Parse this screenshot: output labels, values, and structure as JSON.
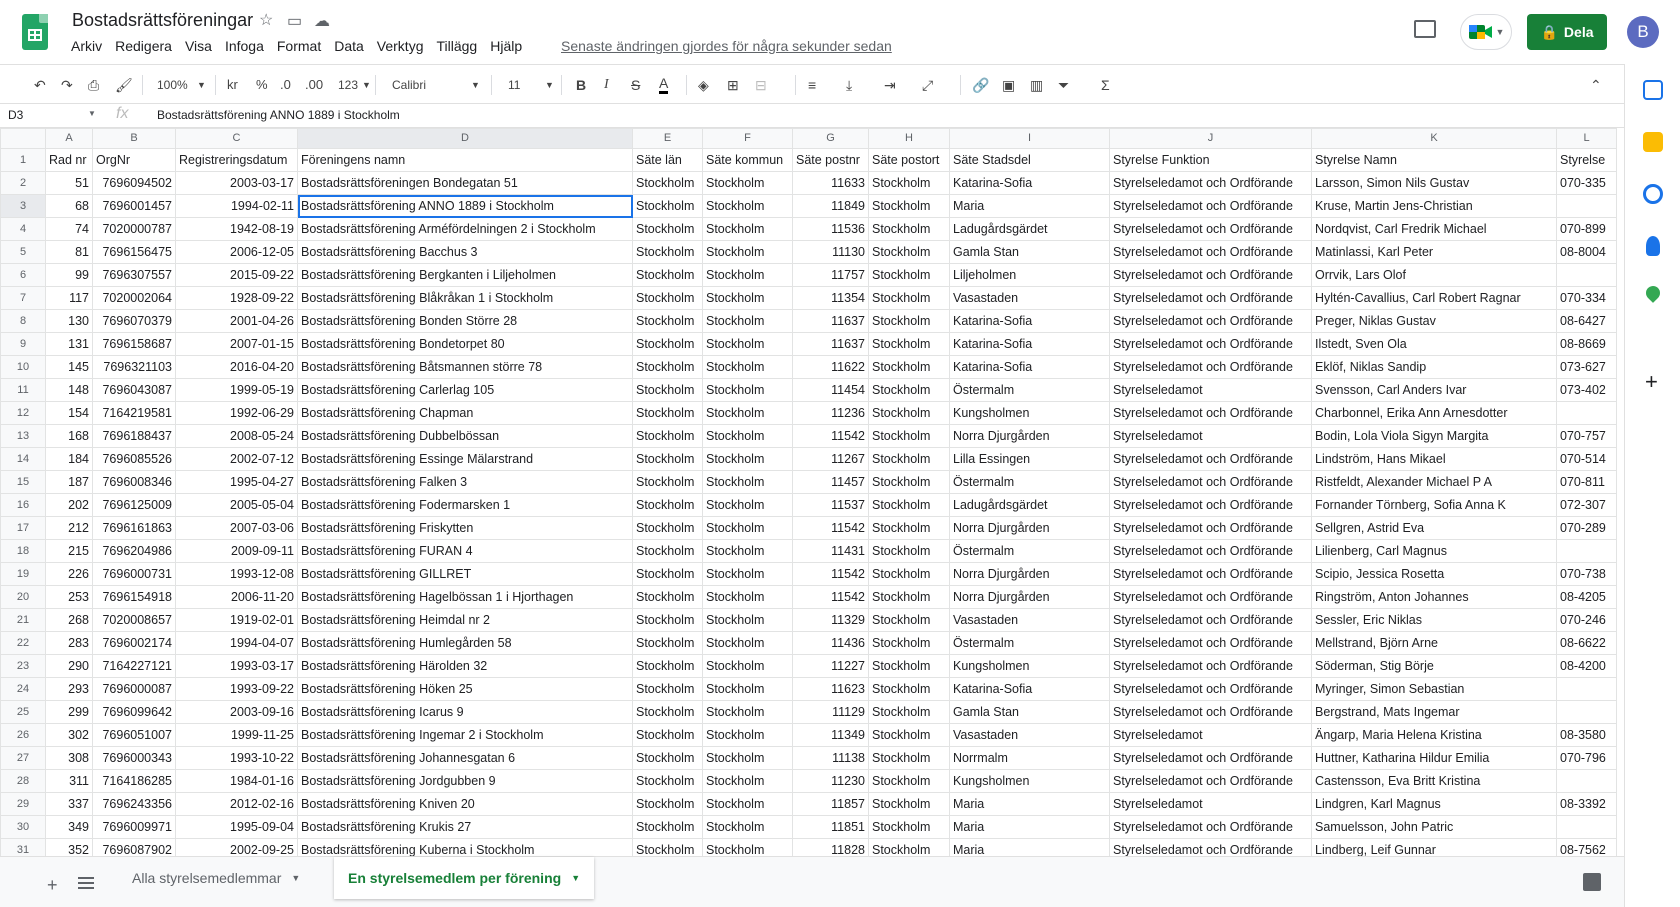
{
  "header": {
    "doc_title": "Bostadsrättsföreningar",
    "menu": [
      "Arkiv",
      "Redigera",
      "Visa",
      "Infoga",
      "Format",
      "Data",
      "Verktyg",
      "Tillägg",
      "Hjälp"
    ],
    "last_edit": "Senaste ändringen gjordes för några sekunder sedan",
    "share_label": "Dela",
    "avatar_initial": "B"
  },
  "toolbar": {
    "zoom": "100%",
    "currency": "kr",
    "percent": "%",
    "decrease_decimals": ".0",
    "increase_decimals": ".00",
    "more_formats": "123",
    "font": "Calibri",
    "font_size": "11",
    "bold": "B",
    "italic": "I",
    "strike": "S",
    "text_color": "A"
  },
  "formula_bar": {
    "cell_ref": "D3",
    "fx": "fx",
    "content": "Bostadsrättsförening ANNO 1889 i Stockholm"
  },
  "columns": [
    "A",
    "B",
    "C",
    "D",
    "E",
    "F",
    "G",
    "H",
    "I",
    "J",
    "K",
    "L"
  ],
  "rows": [
    [
      "Rad nr",
      "OrgNr",
      "Registreringsdatum",
      "Föreningens namn",
      "Säte län",
      "Säte kommun",
      "Säte postnr",
      "Säte postort",
      "Säte Stadsdel",
      "Styrelse Funktion",
      "Styrelse Namn",
      "Styrelse"
    ],
    [
      "51",
      "7696094502",
      "2003-03-17",
      "Bostadsrättsföreningen Bondegatan 51",
      "Stockholm",
      "Stockholm",
      "11633",
      "Stockholm",
      "Katarina-Sofia",
      "Styrelseledamot och Ordförande",
      "Larsson, Simon Nils Gustav",
      "070-335"
    ],
    [
      "68",
      "7696001457",
      "1994-02-11",
      "Bostadsrättsförening ANNO 1889 i Stockholm",
      "Stockholm",
      "Stockholm",
      "11849",
      "Stockholm",
      "Maria",
      "Styrelseledamot och Ordförande",
      "Kruse, Martin Jens-Christian",
      ""
    ],
    [
      "74",
      "7020000787",
      "1942-08-19",
      "Bostadsrättsförening Arméfördelningen 2 i Stockholm",
      "Stockholm",
      "Stockholm",
      "11536",
      "Stockholm",
      "Ladugårdsgärdet",
      "Styrelseledamot och Ordförande",
      "Nordqvist, Carl Fredrik Michael",
      "070-899"
    ],
    [
      "81",
      "7696156475",
      "2006-12-05",
      "Bostadsrättsförening Bacchus 3",
      "Stockholm",
      "Stockholm",
      "11130",
      "Stockholm",
      "Gamla Stan",
      "Styrelseledamot och Ordförande",
      "Matinlassi, Karl Peter",
      "08-8004"
    ],
    [
      "99",
      "7696307557",
      "2015-09-22",
      "Bostadsrättsförening Bergkanten i Liljeholmen",
      "Stockholm",
      "Stockholm",
      "11757",
      "Stockholm",
      "Liljeholmen",
      "Styrelseledamot och Ordförande",
      "Orrvik, Lars Olof",
      ""
    ],
    [
      "117",
      "7020002064",
      "1928-09-22",
      "Bostadsrättsförening Blåkråkan 1 i Stockholm",
      "Stockholm",
      "Stockholm",
      "11354",
      "Stockholm",
      "Vasastaden",
      "Styrelseledamot och Ordförande",
      "Hyltén-Cavallius, Carl Robert Ragnar",
      "070-334"
    ],
    [
      "130",
      "7696070379",
      "2001-04-26",
      "Bostadsrättsförening Bonden Större 28",
      "Stockholm",
      "Stockholm",
      "11637",
      "Stockholm",
      "Katarina-Sofia",
      "Styrelseledamot och Ordförande",
      "Preger, Niklas Gustav",
      "08-6427"
    ],
    [
      "131",
      "7696158687",
      "2007-01-15",
      "Bostadsrättsförening Bondetorpet 80",
      "Stockholm",
      "Stockholm",
      "11637",
      "Stockholm",
      "Katarina-Sofia",
      "Styrelseledamot och Ordförande",
      "Ilstedt, Sven Ola",
      "08-8669"
    ],
    [
      "145",
      "7696321103",
      "2016-04-20",
      "Bostadsrättsförening Båtsmannen större 78",
      "Stockholm",
      "Stockholm",
      "11622",
      "Stockholm",
      "Katarina-Sofia",
      "Styrelseledamot och Ordförande",
      "Eklöf, Niklas Sandip",
      "073-627"
    ],
    [
      "148",
      "7696043087",
      "1999-05-19",
      "Bostadsrättsförening Carlerlag 105",
      "Stockholm",
      "Stockholm",
      "11454",
      "Stockholm",
      "Östermalm",
      "Styrelseledamot",
      "Svensson, Carl Anders Ivar",
      "073-402"
    ],
    [
      "154",
      "7164219581",
      "1992-06-29",
      "Bostadsrättsförening Chapman",
      "Stockholm",
      "Stockholm",
      "11236",
      "Stockholm",
      "Kungsholmen",
      "Styrelseledamot och Ordförande",
      "Charbonnel, Erika Ann Arnesdotter",
      ""
    ],
    [
      "168",
      "7696188437",
      "2008-05-24",
      "Bostadsrättsförening Dubbelbössan",
      "Stockholm",
      "Stockholm",
      "11542",
      "Stockholm",
      "Norra Djurgården",
      "Styrelseledamot",
      "Bodin, Lola Viola Sigyn Margita",
      "070-757"
    ],
    [
      "184",
      "7696085526",
      "2002-07-12",
      "Bostadsrättsförening Essinge Mälarstrand",
      "Stockholm",
      "Stockholm",
      "11267",
      "Stockholm",
      "Lilla Essingen",
      "Styrelseledamot och Ordförande",
      "Lindström, Hans Mikael",
      "070-514"
    ],
    [
      "187",
      "7696008346",
      "1995-04-27",
      "Bostadsrättsförening Falken 3",
      "Stockholm",
      "Stockholm",
      "11457",
      "Stockholm",
      "Östermalm",
      "Styrelseledamot och Ordförande",
      "Ristfeldt, Alexander Michael P A",
      "070-811"
    ],
    [
      "202",
      "7696125009",
      "2005-05-04",
      "Bostadsrättsförening Fodermarsken 1",
      "Stockholm",
      "Stockholm",
      "11537",
      "Stockholm",
      "Ladugårdsgärdet",
      "Styrelseledamot och Ordförande",
      "Fornander Törnberg, Sofia Anna K",
      "072-307"
    ],
    [
      "212",
      "7696161863",
      "2007-03-06",
      "Bostadsrättsförening Friskytten",
      "Stockholm",
      "Stockholm",
      "11542",
      "Stockholm",
      "Norra Djurgården",
      "Styrelseledamot och Ordförande",
      "Sellgren, Astrid Eva",
      "070-289"
    ],
    [
      "215",
      "7696204986",
      "2009-09-11",
      "Bostadsrättsförening FURAN 4",
      "Stockholm",
      "Stockholm",
      "11431",
      "Stockholm",
      "Östermalm",
      "Styrelseledamot och Ordförande",
      "Lilienberg, Carl Magnus",
      ""
    ],
    [
      "226",
      "7696000731",
      "1993-12-08",
      "Bostadsrättsförening GILLRET",
      "Stockholm",
      "Stockholm",
      "11542",
      "Stockholm",
      "Norra Djurgården",
      "Styrelseledamot och Ordförande",
      "Scipio, Jessica Rosetta",
      "070-738"
    ],
    [
      "253",
      "7696154918",
      "2006-11-20",
      "Bostadsrättsförening Hagelbössan 1 i Hjorthagen",
      "Stockholm",
      "Stockholm",
      "11542",
      "Stockholm",
      "Norra Djurgården",
      "Styrelseledamot och Ordförande",
      "Ringström, Anton Johannes",
      "08-4205"
    ],
    [
      "268",
      "7020008657",
      "1919-02-01",
      "Bostadsrättsförening Heimdal nr 2",
      "Stockholm",
      "Stockholm",
      "11329",
      "Stockholm",
      "Vasastaden",
      "Styrelseledamot och Ordförande",
      "Sessler, Eric Niklas",
      "070-246"
    ],
    [
      "283",
      "7696002174",
      "1994-04-07",
      "Bostadsrättsförening Humlegården 58",
      "Stockholm",
      "Stockholm",
      "11436",
      "Stockholm",
      "Östermalm",
      "Styrelseledamot och Ordförande",
      "Mellstrand, Björn Arne",
      "08-6622"
    ],
    [
      "290",
      "7164227121",
      "1993-03-17",
      "Bostadsrättsförening Härolden 32",
      "Stockholm",
      "Stockholm",
      "11227",
      "Stockholm",
      "Kungsholmen",
      "Styrelseledamot och Ordförande",
      "Söderman, Stig Börje",
      "08-4200"
    ],
    [
      "293",
      "7696000087",
      "1993-09-22",
      "Bostadsrättsförening Höken 25",
      "Stockholm",
      "Stockholm",
      "11623",
      "Stockholm",
      "Katarina-Sofia",
      "Styrelseledamot och Ordförande",
      "Myringer, Simon Sebastian",
      ""
    ],
    [
      "299",
      "7696099642",
      "2003-09-16",
      "Bostadsrättsförening Icarus 9",
      "Stockholm",
      "Stockholm",
      "11129",
      "Stockholm",
      "Gamla Stan",
      "Styrelseledamot och Ordförande",
      "Bergstrand, Mats Ingemar",
      ""
    ],
    [
      "302",
      "7696051007",
      "1999-11-25",
      "Bostadsrättsförening Ingemar 2 i Stockholm",
      "Stockholm",
      "Stockholm",
      "11349",
      "Stockholm",
      "Vasastaden",
      "Styrelseledamot",
      "Ängarp, Maria Helena Kristina",
      "08-3580"
    ],
    [
      "308",
      "7696000343",
      "1993-10-22",
      "Bostadsrättsförening Johannesgatan 6",
      "Stockholm",
      "Stockholm",
      "11138",
      "Stockholm",
      "Norrmalm",
      "Styrelseledamot och Ordförande",
      "Huttner, Katharina Hildur Emilia",
      "070-796"
    ],
    [
      "311",
      "7164186285",
      "1984-01-16",
      "Bostadsrättsförening Jordgubben 9",
      "Stockholm",
      "Stockholm",
      "11230",
      "Stockholm",
      "Kungsholmen",
      "Styrelseledamot och Ordförande",
      "Castensson, Eva Britt Kristina",
      ""
    ],
    [
      "337",
      "7696243356",
      "2012-02-16",
      "Bostadsrättsförening Kniven 20",
      "Stockholm",
      "Stockholm",
      "11857",
      "Stockholm",
      "Maria",
      "Styrelseledamot",
      "Lindgren, Karl Magnus",
      "08-3392"
    ],
    [
      "349",
      "7696009971",
      "1995-09-04",
      "Bostadsrättsförening Krukis 27",
      "Stockholm",
      "Stockholm",
      "11851",
      "Stockholm",
      "Maria",
      "Styrelseledamot och Ordförande",
      "Samuelsson, John Patric",
      ""
    ],
    [
      "352",
      "7696087902",
      "2002-09-25",
      "Bostadsrättsförening Kuberna i Stockholm",
      "Stockholm",
      "Stockholm",
      "11828",
      "Stockholm",
      "Maria",
      "Styrelseledamot och Ordförande",
      "Lindberg, Leif Gunnar",
      "08-7562"
    ]
  ],
  "sheets": [
    {
      "label": "Alla styrelsemedlemmar",
      "active": false
    },
    {
      "label": "En styrelsemedlem per förening",
      "active": true
    }
  ],
  "colors": {
    "accent": "#188038",
    "selection": "#1a73e8"
  }
}
